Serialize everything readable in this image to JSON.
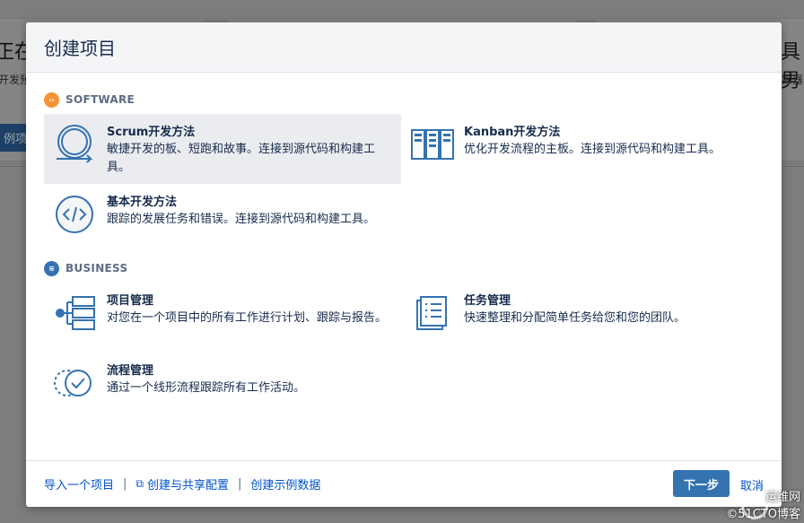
{
  "background": {
    "left_text": "正在",
    "left_sub": "开发预",
    "left_btn": "例项",
    "right_text": "具男",
    "right_sub": "踪器"
  },
  "modal": {
    "title": "创建项目",
    "sections": [
      {
        "label": "SOFTWARE",
        "icon": "code-icon",
        "color": "#f79232",
        "items": [
          {
            "name": "Scrum开发方法",
            "desc": "敏捷开发的板、短跑和故事。连接到源代码和构建工具。",
            "icon": "scrum-cycle-icon",
            "selected": true
          },
          {
            "name": "Kanban开发方法",
            "desc": "优化开发流程的主板。连接到源代码和构建工具。",
            "icon": "kanban-board-icon",
            "selected": false
          },
          {
            "name": "基本开发方法",
            "desc": "跟踪的发展任务和错误。连接到源代码和构建工具。",
            "icon": "code-circle-icon",
            "selected": false
          }
        ]
      },
      {
        "label": "BUSINESS",
        "icon": "list-icon",
        "color": "#3572b0",
        "items": [
          {
            "name": "项目管理",
            "desc": "对您在一个项目中的所有工作进行计划、跟踪与报告。",
            "icon": "project-hierarchy-icon",
            "selected": false
          },
          {
            "name": "任务管理",
            "desc": "快速整理和分配简单任务给您和您的团队。",
            "icon": "task-list-icon",
            "selected": false
          },
          {
            "name": "流程管理",
            "desc": "通过一个线形流程跟踪所有工作活动。",
            "icon": "process-check-icon",
            "selected": false
          }
        ]
      }
    ],
    "footer": {
      "import_link": "导入一个项目",
      "create_shared_link": "创建与共享配置",
      "sample_link": "创建示例数据",
      "next_button": "下一步",
      "cancel_link": "取消"
    }
  },
  "watermark": {
    "line1": "运维网",
    "line2": "©51CTO博客"
  }
}
